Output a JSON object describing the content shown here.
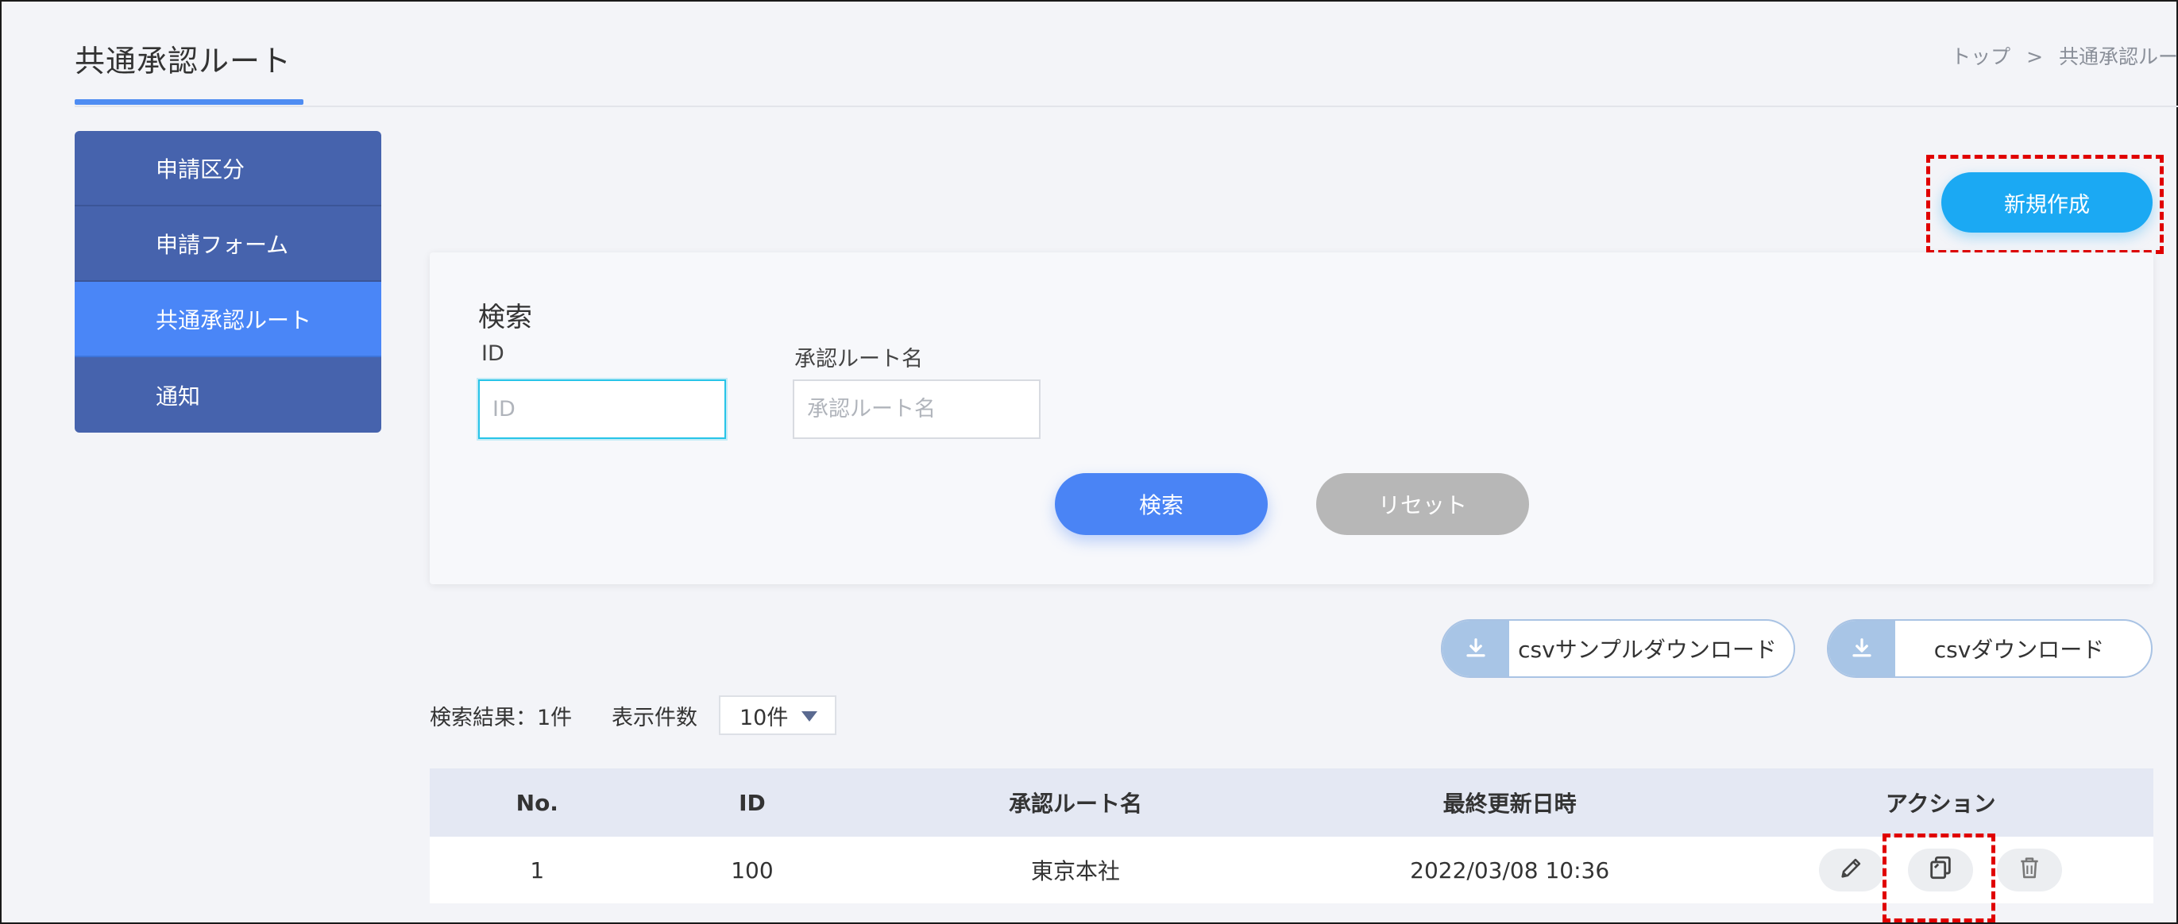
{
  "page": {
    "title": "共通承認ルート"
  },
  "breadcrumb": {
    "home": "トップ",
    "separator": ">",
    "current": "共通承認ルー"
  },
  "sidebar": {
    "items": [
      {
        "label": "申請区分",
        "active": false
      },
      {
        "label": "申請フォーム",
        "active": false
      },
      {
        "label": "共通承認ルート",
        "active": true
      },
      {
        "label": "通知",
        "active": false
      }
    ]
  },
  "toolbar": {
    "new_label": "新規作成"
  },
  "search": {
    "title": "検索",
    "id_label": "ID",
    "id_placeholder": "ID",
    "name_label": "承認ルート名",
    "name_placeholder": "承認ルート名",
    "search_label": "検索",
    "reset_label": "リセット"
  },
  "csv": {
    "sample_label": "csvサンプルダウンロード",
    "download_label": "csvダウンロード",
    "icon": "download-icon"
  },
  "results": {
    "summary": "検索結果：1件",
    "per_page_label": "表示件数",
    "per_page_value": "10件"
  },
  "table": {
    "headers": [
      "No.",
      "ID",
      "承認ルート名",
      "最終更新日時",
      "アクション"
    ],
    "rows": [
      {
        "no": "1",
        "id": "100",
        "name": "東京本社",
        "updated": "2022/03/08 10:36"
      }
    ],
    "action_icons": [
      "pencil-icon",
      "copy-icon",
      "trash-icon"
    ]
  },
  "colors": {
    "sidebar": "#4663ad",
    "sidebar_active": "#4a86f7",
    "primary": "#4a84f5",
    "new_button": "#1ba9f3",
    "reset": "#b7b7b7",
    "highlight": "#e00000"
  }
}
